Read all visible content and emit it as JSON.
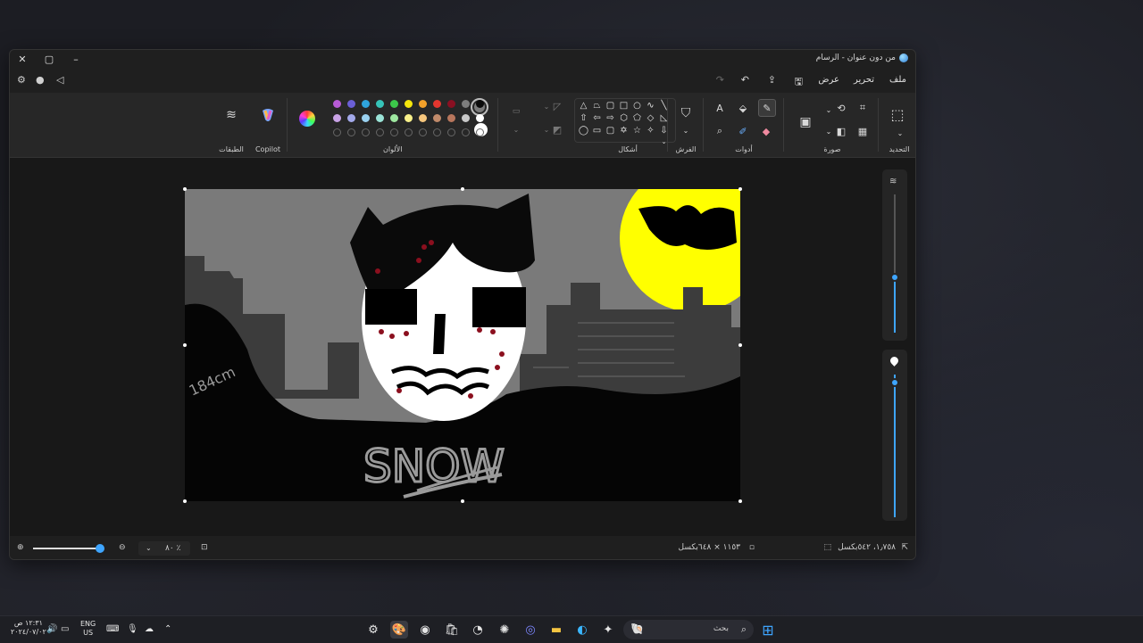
{
  "window": {
    "title": "من دون عنوان - الرسام"
  },
  "menu": {
    "file": "ملف",
    "edit": "تحرير",
    "view": "عرض"
  },
  "ribbon": {
    "groups": {
      "selection": "التحديد",
      "image": "صورة",
      "tools": "أدوات",
      "brushes": "الفرش",
      "shapes": "أشكال",
      "colors": "الألوان",
      "copilot": "Copilot",
      "layers": "الطبقات"
    },
    "palette": {
      "row1": [
        "#b75bd6",
        "#6b5fd6",
        "#2fa4dd",
        "#36c3b8",
        "#3cc84a",
        "#f5e60c",
        "#f3a12a",
        "#e3362f",
        "#8a1022",
        "#7d7d7d",
        "#0b0b0b"
      ],
      "row2": [
        "#c9a3e6",
        "#a3a9ea",
        "#9ad1f0",
        "#9ae3d7",
        "#9ee7a0",
        "#f8f08a",
        "#f6c67d",
        "#c08a6a",
        "#b8765c",
        "#c8c8c8",
        "#ffffff"
      ],
      "primary": "#7a7a7a",
      "secondary": "#ffffff"
    }
  },
  "canvas": {
    "text": "SNOW",
    "annotation": "184cm",
    "colors": {
      "sky": "#7a7a7a",
      "buildings": "#3c3c3c",
      "ground": "#050505",
      "moon": "#ffff00",
      "face": "#ffffff",
      "blood": "#8b0f1e",
      "hair": "#0a0a0a"
    }
  },
  "status": {
    "cursor": "١٫٧٥٨، ٥٤٢بكسل",
    "size": "١١٥٣ × ٦٤٨بكسل",
    "zoom": "٨٠ ٪"
  },
  "taskbar": {
    "search_placeholder": "بحث",
    "lang": "ENG",
    "region": "US",
    "time": "١٢:٣١ ص",
    "date": "٢٠٢٤/٠٧/٠٢"
  }
}
